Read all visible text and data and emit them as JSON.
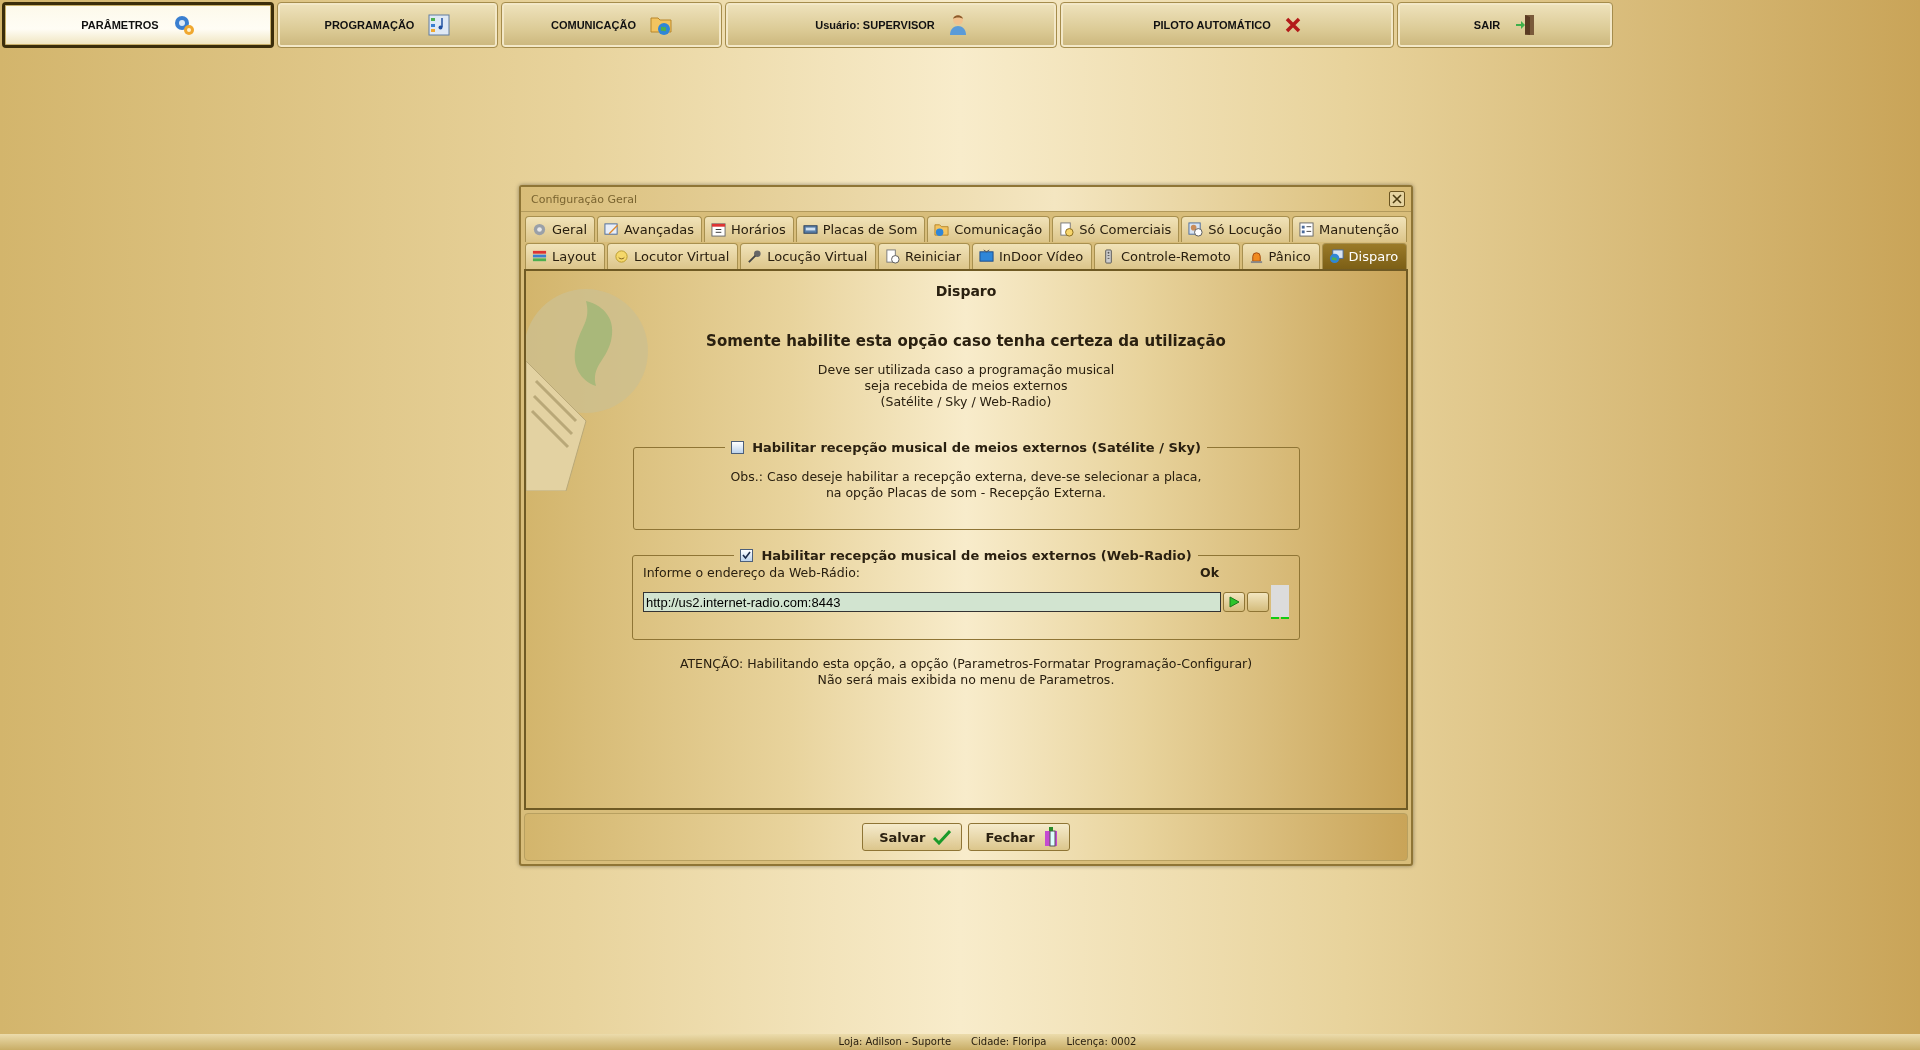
{
  "menu_bar": [
    {
      "label": "PARÂMETROS",
      "selected": true
    },
    {
      "label": "PROGRAMAÇÃO",
      "selected": false
    },
    {
      "label": "COMUNICAÇÃO",
      "selected": false
    },
    {
      "label": "Usuário: SUPERVISOR",
      "selected": false
    },
    {
      "label": "PILOTO AUTOMÁTICO",
      "selected": false
    },
    {
      "label": "SAIR",
      "selected": false
    }
  ],
  "dialog": {
    "title": "Configuração Geral",
    "tab_rows": [
      {
        "tabs": [
          {
            "label": "Geral",
            "selected": false
          },
          {
            "label": "Avançadas",
            "selected": false
          },
          {
            "label": "Horários",
            "selected": false
          },
          {
            "label": "Placas de Som",
            "selected": false
          },
          {
            "label": "Comunicação",
            "selected": false
          },
          {
            "label": "Só Comerciais",
            "selected": false
          },
          {
            "label": "Só Locução",
            "selected": false
          },
          {
            "label": "Manutenção",
            "selected": false
          }
        ]
      },
      {
        "tabs": [
          {
            "label": "Layout",
            "selected": false
          },
          {
            "label": "Locutor Virtual",
            "selected": false
          },
          {
            "label": "Locução Virtual",
            "selected": false
          },
          {
            "label": "Reiniciar",
            "selected": false
          },
          {
            "label": "InDoor Vídeo",
            "selected": false
          },
          {
            "label": "Controle-Remoto",
            "selected": false
          },
          {
            "label": "Pânico",
            "selected": false
          },
          {
            "label": "Disparo",
            "selected": true
          }
        ]
      }
    ],
    "page_title": "Disparo",
    "warning_heading": "Somente habilite esta opção caso tenha certeza da utilização",
    "description": [
      "Deve ser utilizada caso a programação musical",
      "seja recebida de meios externos",
      "(Satélite / Sky / Web-Radio)"
    ],
    "satellite_group": {
      "label": "Habilitar recepção musical de meios externos (Satélite / Sky)",
      "checked": false,
      "note": [
        "Obs.: Caso deseje habilitar a recepção externa, deve-se selecionar a placa,",
        "na opção Placas de som - Recepção Externa."
      ]
    },
    "webradio_group": {
      "label": "Habilitar recepção musical de meios externos (Web-Radio)",
      "checked": true,
      "field_label": "Informe o endereço da Web-Rádio:",
      "status": "Ok",
      "url": "http://us2.internet-radio.com:8443"
    },
    "attention": [
      "ATENÇÃO: Habilitando esta opção, a opção (Parametros-Formatar Programação-Configurar)",
      "Não será mais exibida no menu de Parametros."
    ],
    "buttons": [
      {
        "label": "Salvar",
        "kind": "save"
      },
      {
        "label": "Fechar",
        "kind": "close"
      }
    ]
  },
  "status_bar": [
    "Loja: Adilson - Suporte",
    "Cidade: Floripa",
    "Licença: 0002"
  ]
}
